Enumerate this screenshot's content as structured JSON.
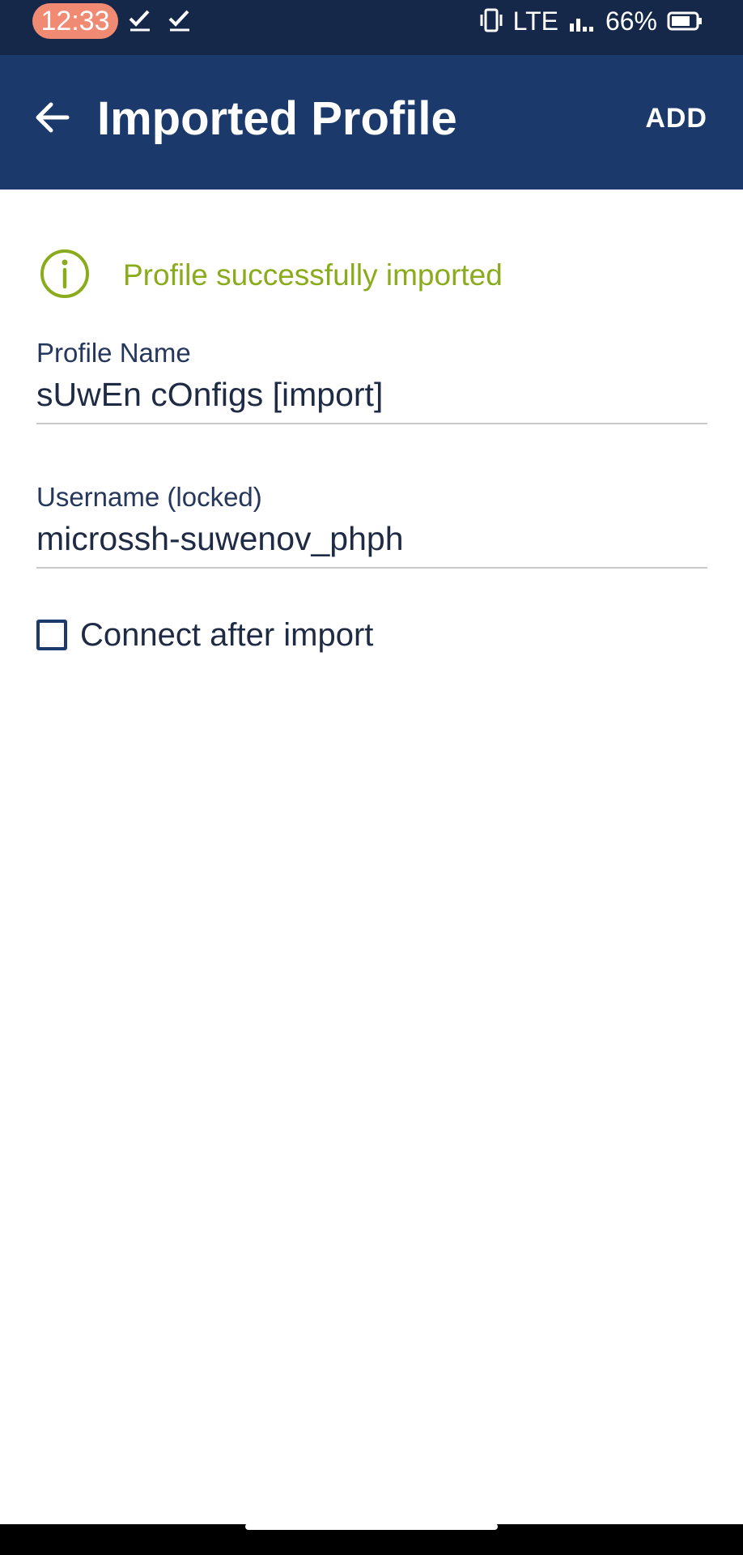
{
  "status_bar": {
    "time": "12:33",
    "network": "LTE",
    "battery": "66%",
    "icons": [
      "check-icon",
      "check-icon",
      "vibrate-icon",
      "signal-icon",
      "battery-icon"
    ]
  },
  "app_bar": {
    "back_icon": "arrow-left-icon",
    "title": "Imported Profile",
    "add_label": "ADD"
  },
  "notice": {
    "icon": "info-circle-icon",
    "text": "Profile successfully imported",
    "color": "#8aab1b"
  },
  "profile_name": {
    "label": "Profile Name",
    "value": "sUwEn cOnfigs [import]"
  },
  "username": {
    "label": "Username (locked)",
    "value": "microssh-suwenov_phph"
  },
  "connect_after_import": {
    "label": "Connect after import",
    "checked": false
  },
  "colors": {
    "status_bar": "#16284a",
    "app_bar": "#1b3a6b",
    "accent_success": "#8aab1b",
    "time_pill": "#f08a72"
  }
}
